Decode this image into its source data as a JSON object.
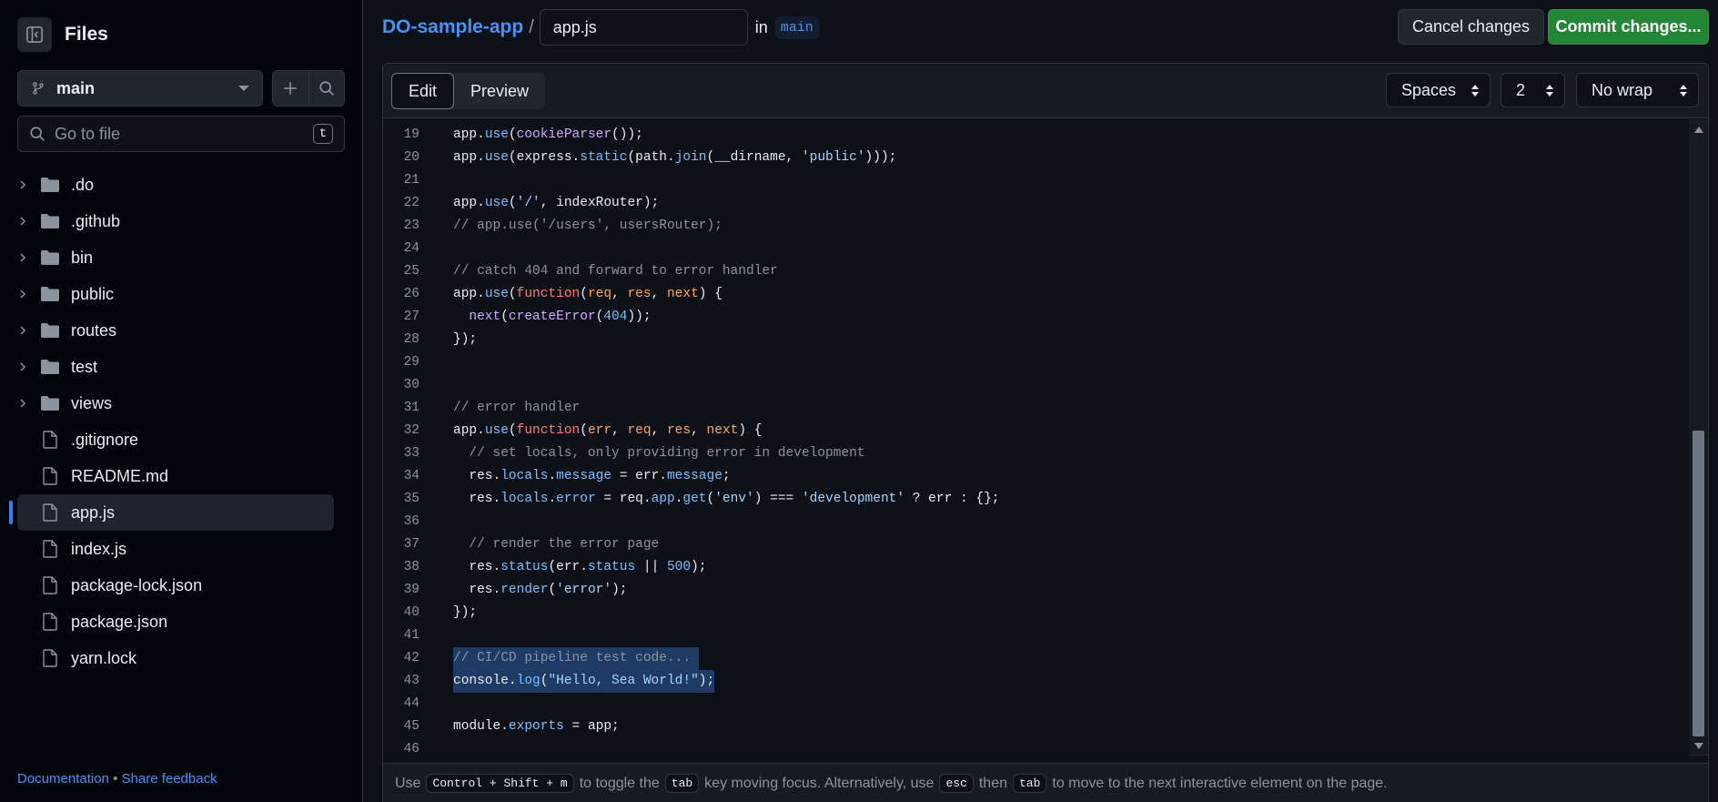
{
  "sidebar": {
    "title": "Files",
    "branch": "main",
    "goto_placeholder": "Go to file",
    "goto_shortcut": "t",
    "items": [
      {
        "label": ".do",
        "type": "folder"
      },
      {
        "label": ".github",
        "type": "folder"
      },
      {
        "label": "bin",
        "type": "folder"
      },
      {
        "label": "public",
        "type": "folder"
      },
      {
        "label": "routes",
        "type": "folder"
      },
      {
        "label": "test",
        "type": "folder"
      },
      {
        "label": "views",
        "type": "folder"
      },
      {
        "label": ".gitignore",
        "type": "file"
      },
      {
        "label": "README.md",
        "type": "file"
      },
      {
        "label": "app.js",
        "type": "file",
        "active": true
      },
      {
        "label": "index.js",
        "type": "file"
      },
      {
        "label": "package-lock.json",
        "type": "file"
      },
      {
        "label": "package.json",
        "type": "file"
      },
      {
        "label": "yarn.lock",
        "type": "file"
      }
    ],
    "footer": {
      "documentation": "Documentation",
      "separator": "•",
      "feedback": "Share feedback"
    }
  },
  "header": {
    "repo": "DO-sample-app",
    "separator": "/",
    "filename": "app.js",
    "in_label": "in",
    "branch": "main",
    "cancel_label": "Cancel changes",
    "commit_label": "Commit changes..."
  },
  "editor": {
    "tab_edit": "Edit",
    "tab_preview": "Preview",
    "indent_mode": "Spaces",
    "indent_size": "2",
    "wrap_mode": "No wrap",
    "lines": [
      {
        "n": "19",
        "tokens": [
          [
            "",
            "app."
          ],
          [
            "c-pr",
            "use"
          ],
          [
            "",
            "("
          ],
          [
            "c-fn",
            "cookieParser"
          ],
          [
            "",
            "());"
          ]
        ]
      },
      {
        "n": "20",
        "tokens": [
          [
            "",
            "app."
          ],
          [
            "c-pr",
            "use"
          ],
          [
            "",
            "(express."
          ],
          [
            "c-pr",
            "static"
          ],
          [
            "",
            "(path."
          ],
          [
            "c-pr",
            "join"
          ],
          [
            "",
            "(__dirname, "
          ],
          [
            "c-str",
            "'public'"
          ],
          [
            "",
            ")));"
          ]
        ]
      },
      {
        "n": "21",
        "tokens": []
      },
      {
        "n": "22",
        "tokens": [
          [
            "",
            "app."
          ],
          [
            "c-pr",
            "use"
          ],
          [
            "",
            "("
          ],
          [
            "c-str",
            "'/'"
          ],
          [
            "",
            ", indexRouter);"
          ]
        ]
      },
      {
        "n": "23",
        "tokens": [
          [
            "c-cm",
            "// app.use('/users', usersRouter);"
          ]
        ]
      },
      {
        "n": "24",
        "tokens": []
      },
      {
        "n": "25",
        "tokens": [
          [
            "c-cm",
            "// catch 404 and forward to error handler"
          ]
        ]
      },
      {
        "n": "26",
        "tokens": [
          [
            "",
            "app."
          ],
          [
            "c-pr",
            "use"
          ],
          [
            "",
            "("
          ],
          [
            "c-kw",
            "function"
          ],
          [
            "",
            "("
          ],
          [
            "c-prm",
            "req"
          ],
          [
            "",
            ", "
          ],
          [
            "c-prm",
            "res"
          ],
          [
            "",
            ", "
          ],
          [
            "c-prm",
            "next"
          ],
          [
            "",
            ") {"
          ]
        ]
      },
      {
        "n": "27",
        "tokens": [
          [
            "",
            "  "
          ],
          [
            "c-fn",
            "next"
          ],
          [
            "",
            "("
          ],
          [
            "c-fn",
            "createError"
          ],
          [
            "",
            "("
          ],
          [
            "c-num",
            "404"
          ],
          [
            "",
            "));"
          ]
        ]
      },
      {
        "n": "28",
        "tokens": [
          [
            "",
            "});"
          ]
        ]
      },
      {
        "n": "29",
        "tokens": []
      },
      {
        "n": "30",
        "tokens": []
      },
      {
        "n": "31",
        "tokens": [
          [
            "c-cm",
            "// error handler"
          ]
        ]
      },
      {
        "n": "32",
        "tokens": [
          [
            "",
            "app."
          ],
          [
            "c-pr",
            "use"
          ],
          [
            "",
            "("
          ],
          [
            "c-kw",
            "function"
          ],
          [
            "",
            "("
          ],
          [
            "c-prm",
            "err"
          ],
          [
            "",
            ", "
          ],
          [
            "c-prm",
            "req"
          ],
          [
            "",
            ", "
          ],
          [
            "c-prm",
            "res"
          ],
          [
            "",
            ", "
          ],
          [
            "c-prm",
            "next"
          ],
          [
            "",
            ") {"
          ]
        ]
      },
      {
        "n": "33",
        "tokens": [
          [
            "c-cm",
            "  // set locals, only providing error in development"
          ]
        ]
      },
      {
        "n": "34",
        "tokens": [
          [
            "",
            "  res."
          ],
          [
            "c-pr",
            "locals"
          ],
          [
            "",
            "."
          ],
          [
            "c-pr",
            "message"
          ],
          [
            "",
            " = err."
          ],
          [
            "c-pr",
            "message"
          ],
          [
            "",
            ";"
          ]
        ]
      },
      {
        "n": "35",
        "tokens": [
          [
            "",
            "  res."
          ],
          [
            "c-pr",
            "locals"
          ],
          [
            "",
            "."
          ],
          [
            "c-pr",
            "error"
          ],
          [
            "",
            " = req."
          ],
          [
            "c-pr",
            "app"
          ],
          [
            "",
            "."
          ],
          [
            "c-pr",
            "get"
          ],
          [
            "",
            "("
          ],
          [
            "c-str",
            "'env'"
          ],
          [
            "",
            ") === "
          ],
          [
            "c-str",
            "'development'"
          ],
          [
            "",
            " ? err : {};"
          ]
        ]
      },
      {
        "n": "36",
        "tokens": []
      },
      {
        "n": "37",
        "tokens": [
          [
            "c-cm",
            "  // render the error page"
          ]
        ]
      },
      {
        "n": "38",
        "tokens": [
          [
            "",
            "  res."
          ],
          [
            "c-pr",
            "status"
          ],
          [
            "",
            "(err."
          ],
          [
            "c-pr",
            "status"
          ],
          [
            "",
            " || "
          ],
          [
            "c-num",
            "500"
          ],
          [
            "",
            ");"
          ]
        ]
      },
      {
        "n": "39",
        "tokens": [
          [
            "",
            "  res."
          ],
          [
            "c-pr",
            "render"
          ],
          [
            "",
            "("
          ],
          [
            "c-str",
            "'error'"
          ],
          [
            "",
            ");"
          ]
        ]
      },
      {
        "n": "40",
        "tokens": [
          [
            "",
            "});"
          ]
        ]
      },
      {
        "n": "41",
        "tokens": []
      },
      {
        "n": "42",
        "hl": true,
        "tokens": [
          [
            "c-cm",
            "// CI/CD pipeline test code... "
          ]
        ]
      },
      {
        "n": "43",
        "hl": true,
        "tokens": [
          [
            "",
            "console."
          ],
          [
            "c-pr",
            "log"
          ],
          [
            "",
            "("
          ],
          [
            "c-str",
            "\"Hello, Sea World!\""
          ],
          [
            "",
            ");"
          ]
        ]
      },
      {
        "n": "44",
        "tokens": []
      },
      {
        "n": "45",
        "tokens": [
          [
            "",
            "module."
          ],
          [
            "c-pr",
            "exports"
          ],
          [
            "",
            " = app;"
          ]
        ]
      },
      {
        "n": "46",
        "tokens": []
      }
    ],
    "footer": {
      "t1": "Use",
      "k1": "Control + Shift + m",
      "t2": "to toggle the",
      "k2": "tab",
      "t3": "key moving focus. Alternatively, use",
      "k3": "esc",
      "t4": "then",
      "k4": "tab",
      "t5": "to move to the next interactive element on the page."
    }
  },
  "colors": {
    "accent": "#4493f8",
    "commit": "#238636",
    "selection": "#1d3b64"
  }
}
